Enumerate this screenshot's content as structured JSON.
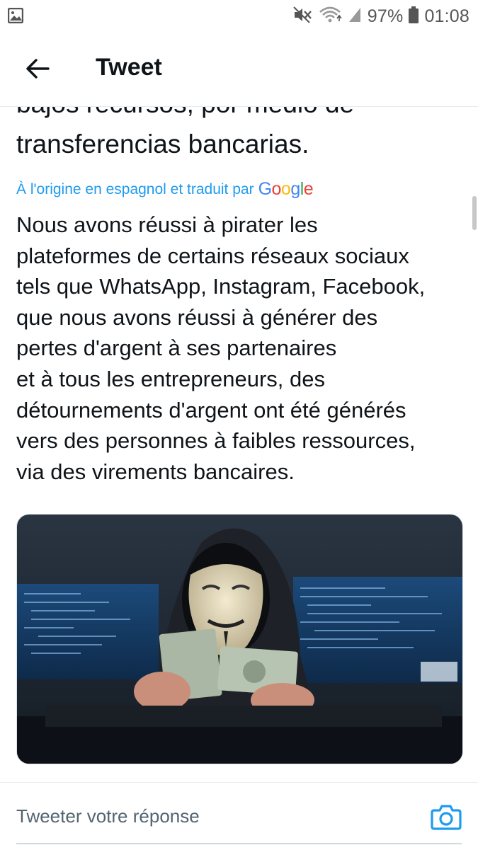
{
  "status_bar": {
    "battery_percent": "97%",
    "time": "01:08",
    "icons": [
      "gallery-notification-icon",
      "mute-icon",
      "wifi-icon",
      "signal-icon",
      "battery-icon"
    ]
  },
  "header": {
    "title": "Tweet",
    "back_icon": "arrow-left-icon"
  },
  "tweet": {
    "original_partial_line": "bajos recursos, por medio de",
    "original_last_line": "transferencias bancarias.",
    "translation_note": "À l'origine en espagnol et traduit par",
    "translation_provider": "Google",
    "translated_lines": [
      "Nous avons réussi à pirater les",
      "plateformes de certains réseaux sociaux",
      "tels que WhatsApp, Instagram, Facebook,",
      "que nous avons réussi à générer des",
      "pertes d'argent à ses partenaires",
      "et à tous les entrepreneurs, des",
      "détournements d'argent ont été générés",
      "vers des personnes à faibles ressources,",
      "via des virements bancaires."
    ],
    "media_description_icon": "photo"
  },
  "reply": {
    "placeholder": "Tweeter votre réponse",
    "camera_icon": "camera-icon"
  },
  "colors": {
    "accent": "#1d9bf0",
    "text": "#0f1419",
    "secondary": "#536471"
  }
}
